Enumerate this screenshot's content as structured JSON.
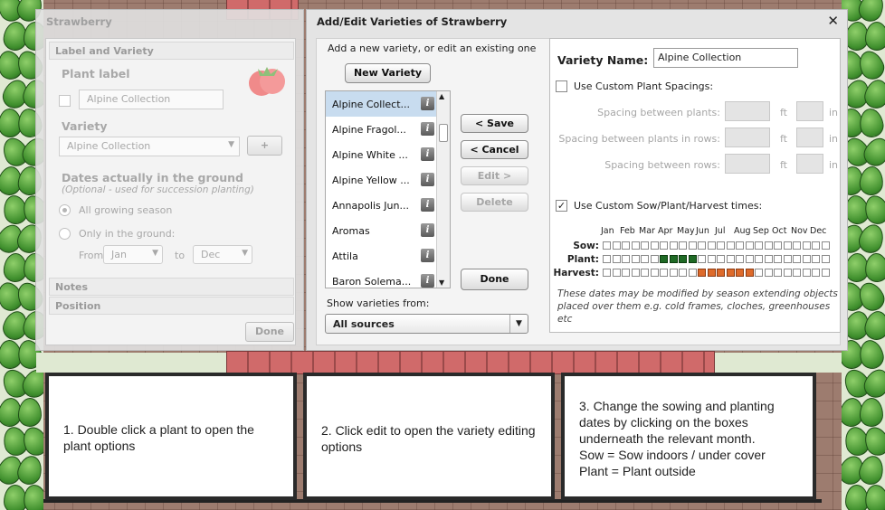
{
  "left_dialog": {
    "title": "Strawberry",
    "section_label_variety": "Label and Variety",
    "plant_label_heading": "Plant label",
    "plant_label_value": "Alpine Collection",
    "variety_heading": "Variety",
    "variety_value": "Alpine Collection",
    "add_button": "+",
    "dates_heading": "Dates actually in the ground",
    "dates_subtitle": "(Optional - used for succession planting)",
    "radio_all": "All growing season",
    "radio_only": "Only in the ground:",
    "from_label": "From",
    "from_value": "Jan",
    "to_label": "to",
    "to_value": "Dec",
    "section_notes": "Notes",
    "section_position": "Position",
    "done_button": "Done"
  },
  "main_dialog": {
    "title": "Add/Edit Varieties of Strawberry",
    "close_icon": "close-icon",
    "instruction": "Add a new variety, or edit an existing one",
    "new_variety_button": "New Variety",
    "varieties": [
      "Alpine Collect...",
      "Alpine Fragol...",
      "Alpine White ...",
      "Alpine Yellow ...",
      "Annapolis Jun...",
      "Aromas",
      "Attila",
      "Baron Solema..."
    ],
    "selected_variety_index": 0,
    "save_button": "< Save",
    "cancel_button": "< Cancel",
    "edit_button": "Edit >",
    "delete_button": "Delete",
    "done_button": "Done",
    "show_from_label": "Show varieties from:",
    "show_from_value": "All sources",
    "variety_name_label": "Variety Name:",
    "variety_name_value": "Alpine Collection",
    "custom_spacings_label": "Use Custom Plant Spacings:",
    "custom_spacings_checked": false,
    "spacing_rows": [
      {
        "label": "Spacing between plants:",
        "unit1": "ft",
        "unit2": "in"
      },
      {
        "label": "Spacing between plants in rows:",
        "unit1": "ft",
        "unit2": "in"
      },
      {
        "label": "Spacing between rows:",
        "unit1": "ft",
        "unit2": "in"
      }
    ],
    "custom_times_label": "Use Custom Sow/Plant/Harvest times:",
    "custom_times_checked": true,
    "months": [
      "Jan",
      "Feb",
      "Mar",
      "Apr",
      "May",
      "Jun",
      "Jul",
      "Aug",
      "Sep",
      "Oct",
      "Nov",
      "Dec"
    ],
    "calendar_rows": [
      {
        "label": "Sow:",
        "filled_months": [],
        "color": "#1f6a25"
      },
      {
        "label": "Plant:",
        "filled_months": [
          "Apr",
          "May"
        ],
        "color": "#1f6a25"
      },
      {
        "label": "Harvest:",
        "filled_months": [
          "Jun",
          "Jul",
          "Aug"
        ],
        "color": "#de6a2a"
      }
    ],
    "calendar_note": "These dates may be modified by season extending objects placed over them e.g. cold frames, cloches, greenhouses etc"
  },
  "callouts": [
    {
      "text": "1. Double click a plant to open the plant options"
    },
    {
      "text": "2. Click edit to open the variety editing options"
    },
    {
      "text": "3. Change the sowing and planting dates by clicking on the boxes underneath the relevant month.\nSow = Sow indoors / under cover\nPlant = Plant outside"
    }
  ]
}
